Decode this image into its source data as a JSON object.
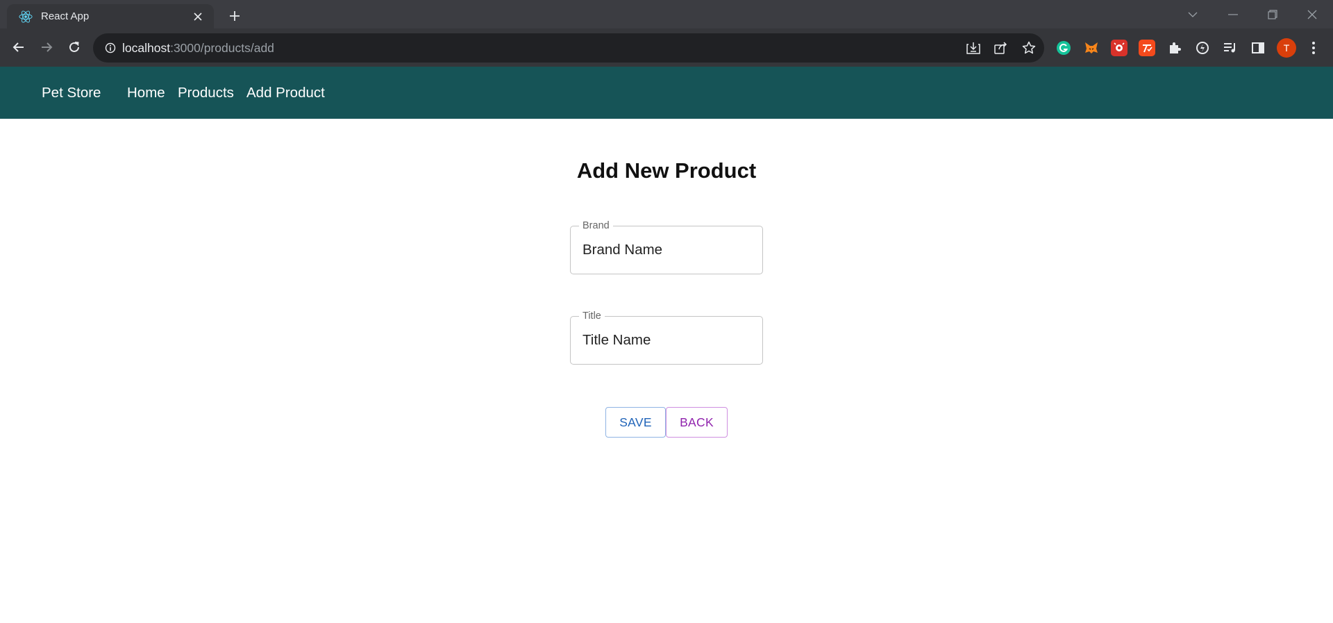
{
  "browser": {
    "tab": {
      "title": "React App",
      "favicon": "react-icon"
    },
    "address": {
      "host": "localhost",
      "path": ":3000/products/add"
    },
    "avatar_letter": "T",
    "extensions": [
      "grammarly-icon",
      "metamask-icon",
      "rocket-icon",
      "todoist-icon",
      "puzzle-icon",
      "ext-icon",
      "media-icon",
      "side-panel-icon"
    ],
    "colors": {
      "titlebar": "#3c3d42",
      "toolbar": "#35363a",
      "omnibox": "#202124"
    }
  },
  "app": {
    "brand": "Pet Store",
    "nav": [
      "Home",
      "Products",
      "Add Product"
    ],
    "colors": {
      "appbar": "#165457",
      "save": "#1f63b8",
      "back": "#9023ad"
    }
  },
  "form": {
    "title": "Add New Product",
    "brand_field": {
      "label": "Brand",
      "value": "Brand Name"
    },
    "title_field": {
      "label": "Title",
      "value": "Title Name"
    },
    "save_label": "SAVE",
    "back_label": "BACK"
  }
}
